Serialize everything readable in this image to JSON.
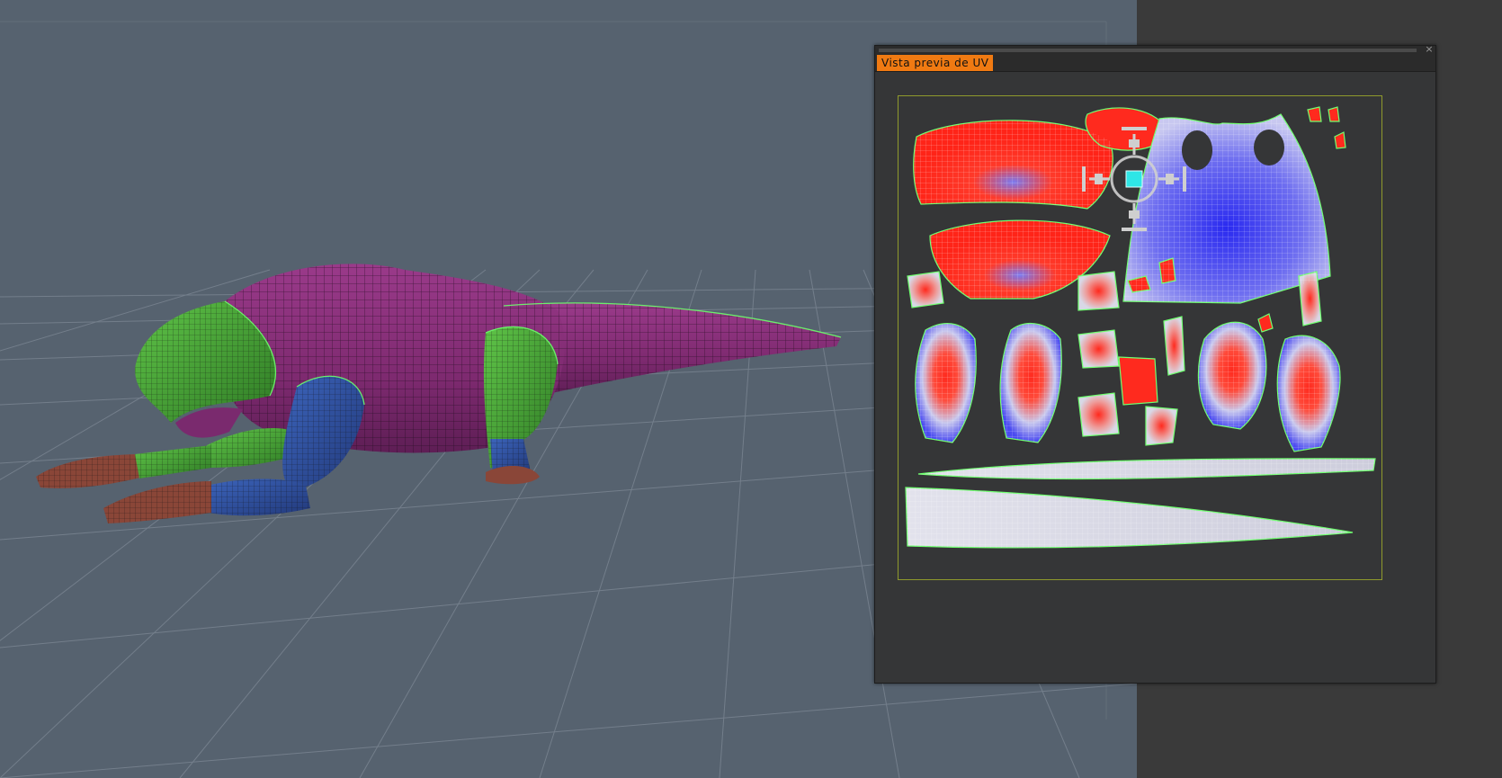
{
  "app": {
    "panel_title": "Vista previa de UV",
    "close_glyph": "×"
  },
  "viewport": {
    "background_color": "#56626f",
    "model_colors": {
      "body": "#8a2f7a",
      "head": "#4aa83a",
      "limb_blue": "#2f4f9a",
      "hand_brown": "#8a4638"
    }
  },
  "uv_preview": {
    "border_color": "#8f9a2c",
    "stretch_colors": [
      "#ff2a1e",
      "#e6e6ee",
      "#3a3af0"
    ],
    "icons": [
      "uv-manipulator-icon"
    ]
  }
}
